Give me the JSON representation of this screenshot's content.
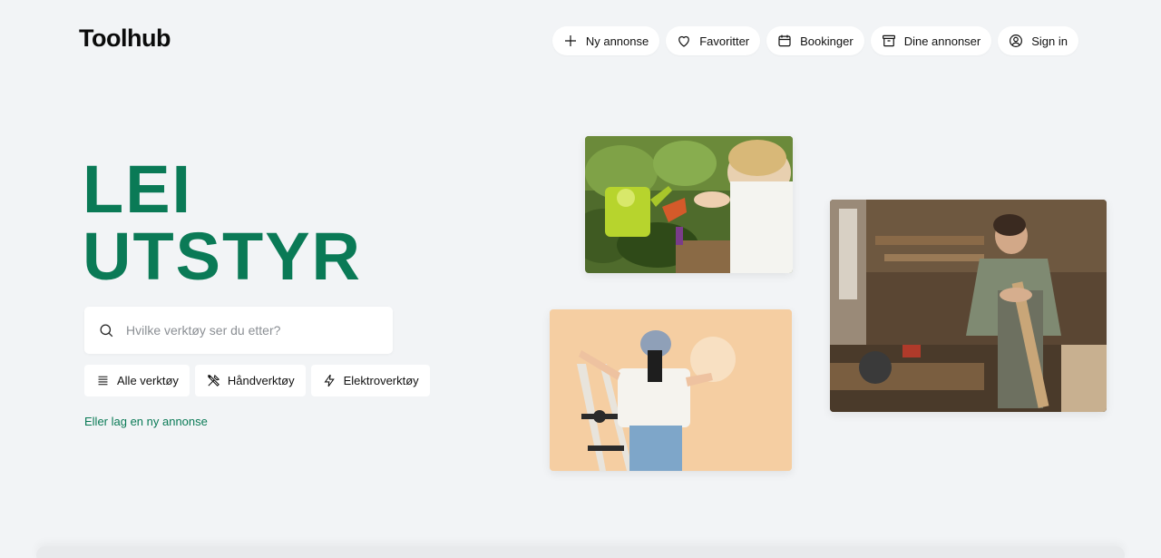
{
  "brand": {
    "logo": "Toolhub"
  },
  "nav": {
    "new_listing": "Ny annonse",
    "favorites": "Favoritter",
    "bookings": "Bookinger",
    "my_listings": "Dine annonser",
    "sign_in": "Sign in"
  },
  "hero": {
    "line1": "LEI",
    "line2": "UTSTYR"
  },
  "search": {
    "placeholder": "Hvilke verktøy ser du etter?",
    "value": ""
  },
  "categories": [
    {
      "label": "Alle verktøy",
      "icon": "list-icon"
    },
    {
      "label": "Håndverktøy",
      "icon": "tools-icon"
    },
    {
      "label": "Elektroverktøy",
      "icon": "lightning-icon"
    }
  ],
  "cta": {
    "new_listing_link": "Eller lag en ny annonse"
  },
  "colors": {
    "accent": "#0a7a56",
    "background": "#f2f4f6"
  }
}
